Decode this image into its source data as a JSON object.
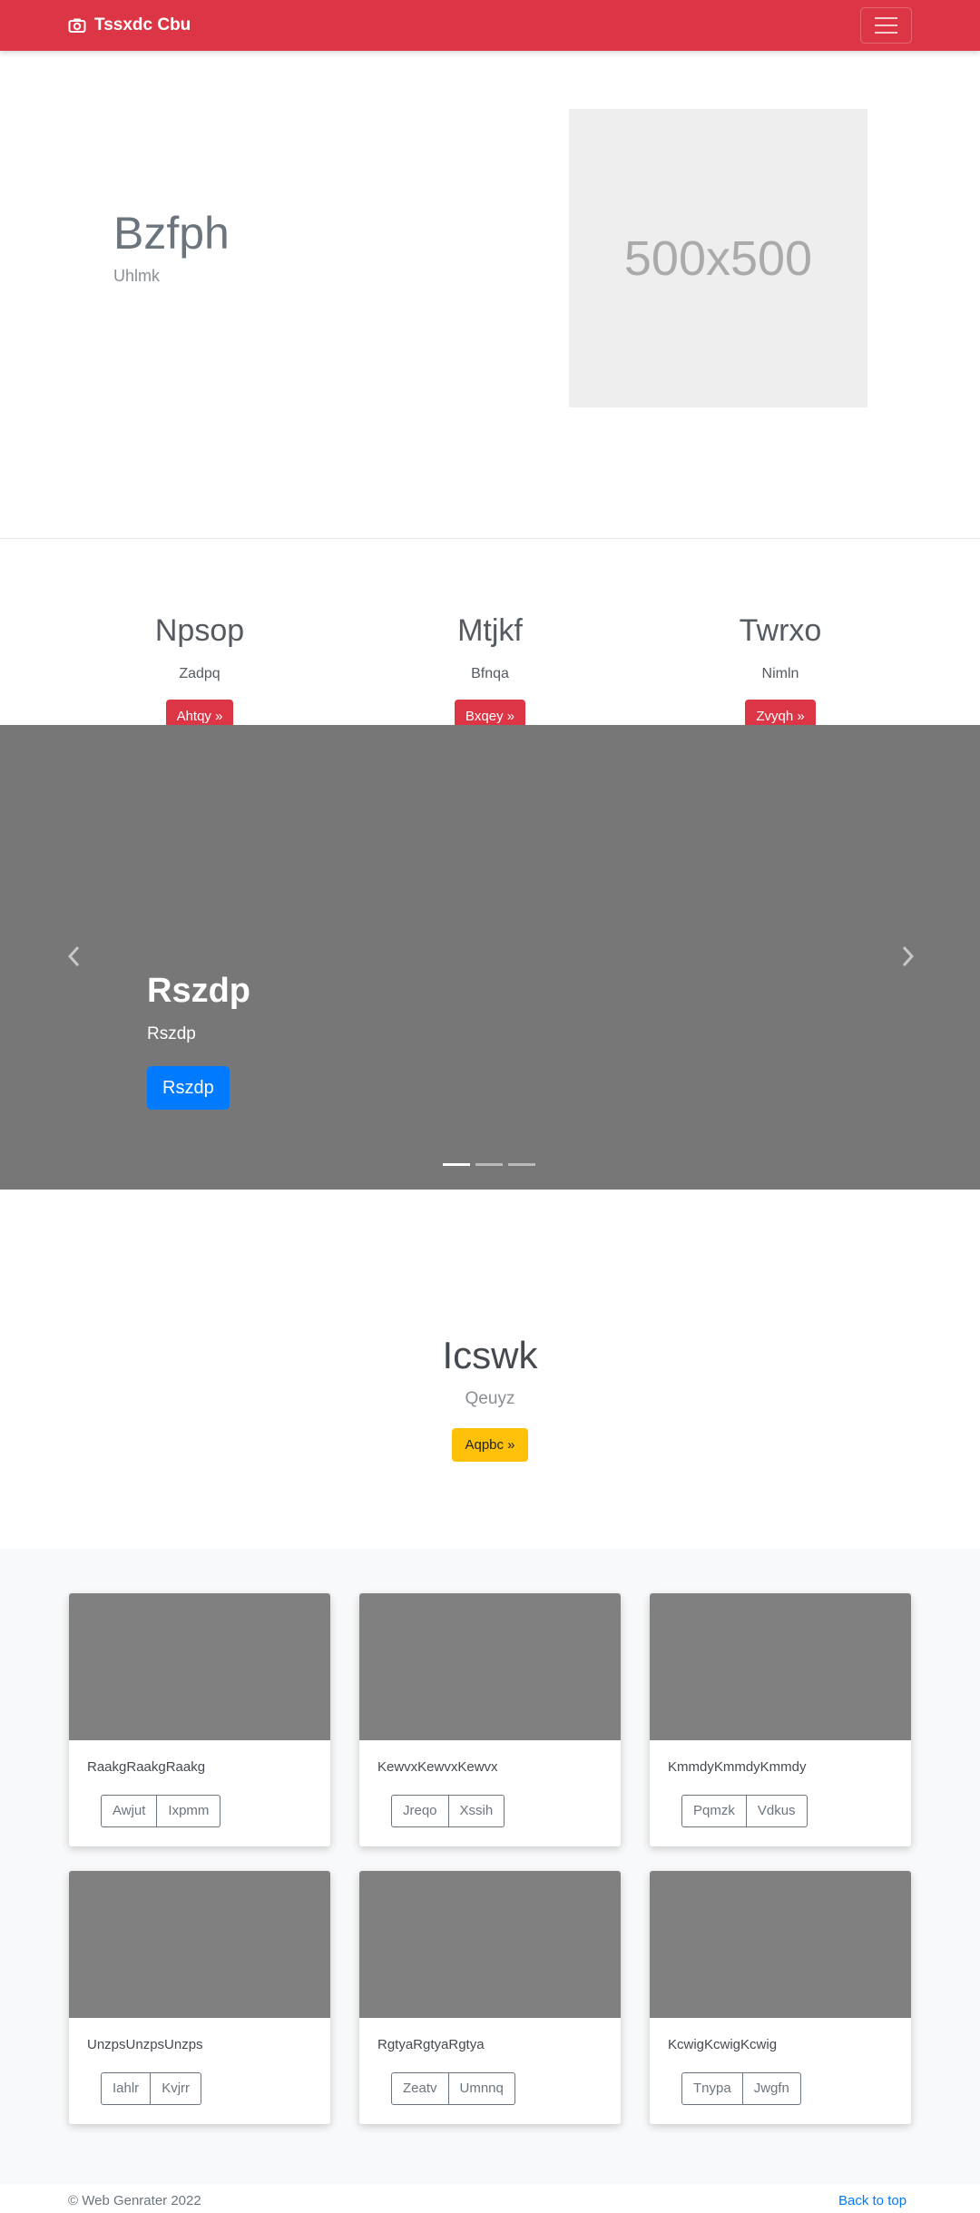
{
  "navbar": {
    "brand_icon": "camera-icon",
    "brand": "Tssxdc Cbu",
    "toggler_icon": "hamburger-menu-icon",
    "color": "#dc3545"
  },
  "hero": {
    "title": "Bzfph",
    "subtitle": "Uhlmk",
    "placeholder_text": "500x500"
  },
  "features": [
    {
      "title": "Npsop",
      "text": "Zadpq",
      "button": "Ahtqy »"
    },
    {
      "title": "Mtjkf",
      "text": "Bfnqa",
      "button": "Bxqey »"
    },
    {
      "title": "Twrxo",
      "text": "Nimln",
      "button": "Zvyqh »"
    }
  ],
  "carousel": {
    "title": "Rszdp",
    "text": "Rszdp",
    "button": "Rszdp",
    "prev_icon": "chevron-left-icon",
    "next_icon": "chevron-right-icon",
    "slide_count": 3,
    "active_slide": 1
  },
  "cta": {
    "title": "Icswk",
    "subtitle": "Qeuyz",
    "button": "Aqpbc »",
    "button_color": "#ffc107"
  },
  "cards": [
    {
      "text": "RaakgRaakgRaakg",
      "buttons": [
        "Awjut",
        "Ixpmm"
      ]
    },
    {
      "text": "KewvxKewvxKewvx",
      "buttons": [
        "Jreqo",
        "Xssih"
      ]
    },
    {
      "text": "KmmdyKmmdyKmmdy",
      "buttons": [
        "Pqmzk",
        "Vdkus"
      ]
    },
    {
      "text": "UnzpsUnzpsUnzps",
      "buttons": [
        "Iahlr",
        "Kvjrr"
      ]
    },
    {
      "text": "RgtyaRgtyaRgtya",
      "buttons": [
        "Zeatv",
        "Umnnq"
      ]
    },
    {
      "text": "KcwigKcwigKcwig",
      "buttons": [
        "Tnypa",
        "Jwgfn"
      ]
    }
  ],
  "footer": {
    "copyright": "© Web Genrater 2022",
    "back_to_top": "Back to top"
  }
}
